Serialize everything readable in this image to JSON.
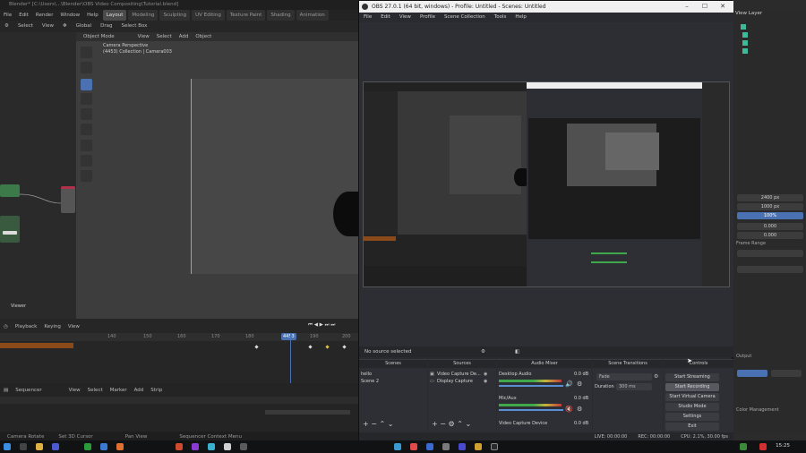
{
  "blender": {
    "title": "Blender* [C:\\Users\\...\\Blender\\OBS Video Compositing\\Tutorial.blend]",
    "menu": [
      "File",
      "Edit",
      "Render",
      "Window",
      "Help"
    ],
    "workspace_tabs": [
      "Layout",
      "Modeling",
      "Sculpting",
      "UV Editing",
      "Texture Paint",
      "Shading",
      "Animation",
      "Rendering",
      "Compositing"
    ],
    "toolbar": [
      "Select",
      "View",
      "Global",
      "Drag",
      "Select Box"
    ],
    "viewport_header": [
      "Object Mode",
      "View",
      "Select",
      "Add",
      "Object"
    ],
    "camera_info": {
      "line1": "Camera Perspective",
      "line2": "(4453) Collection | Camera003"
    },
    "node_label": "Viewer",
    "timeline": {
      "header": [
        "Playback",
        "Keying",
        "View"
      ],
      "ticks": [
        "140",
        "150",
        "160",
        "170",
        "180",
        "190",
        "200"
      ],
      "current_frame": "4453"
    },
    "sequencer": {
      "header": [
        "Sequencer",
        "View",
        "Select",
        "Marker",
        "Add",
        "Strip"
      ]
    },
    "status": [
      "Camera Rotate",
      "Set 3D Cursor",
      "Pan View",
      "Sequencer Context Menu"
    ],
    "properties": {
      "title": "View Layer",
      "fields": [
        "2400 px",
        "1000 px",
        "100%",
        "0.000",
        "0.000"
      ],
      "labels": [
        "Frame Range",
        "Output",
        "Color Management"
      ]
    }
  },
  "obs": {
    "title": "OBS 27.0.1 (64 bit, windows) - Profile: Untitled - Scenes: Untitled",
    "menu": [
      "File",
      "Edit",
      "View",
      "Profile",
      "Scene Collection",
      "Tools",
      "Help"
    ],
    "context_bar": "No source selected",
    "docks": {
      "scenes": {
        "title": "Scenes",
        "items": [
          "hello",
          "Scene 2"
        ]
      },
      "sources": {
        "title": "Sources",
        "items": [
          "Video Capture De...",
          "Display Capture"
        ]
      },
      "mixer": {
        "title": "Audio Mixer",
        "channels": [
          {
            "name": "Desktop Audio",
            "db": "0.0 dB"
          },
          {
            "name": "Mic/Aux",
            "db": "0.0 dB"
          },
          {
            "name": "Video Capture Device",
            "db": "0.0 dB"
          }
        ]
      },
      "transitions": {
        "title": "Scene Transitions",
        "type": "Fade",
        "duration_label": "Duration",
        "duration": "300 ms"
      },
      "controls": {
        "title": "Controls",
        "buttons": [
          "Start Streaming",
          "Start Recording",
          "Start Virtual Camera",
          "Studio Mode",
          "Settings",
          "Exit"
        ]
      }
    },
    "status": {
      "live": "LIVE: 00:00:00",
      "rec": "REC: 00:00:00",
      "cpu": "CPU: 2.1%, 30.00 fps"
    }
  },
  "taskbar": {
    "clock": "15:25"
  }
}
